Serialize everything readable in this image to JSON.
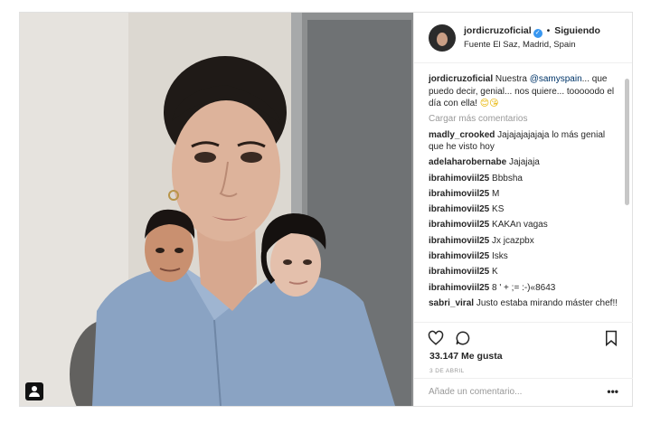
{
  "post": {
    "header": {
      "username": "jordicruzoficial",
      "verified": true,
      "separator": "•",
      "follow_status": "Siguiendo",
      "location": "Fuente El Saz, Madrid, Spain"
    },
    "caption": {
      "username": "jordicruzoficial",
      "text_before": " Nuestra ",
      "mention": "@samyspain",
      "text_after": "... que puedo decir, genial... nos quiere... tooooodo el día con ella! ",
      "emoji": "😊😘"
    },
    "load_more_label": "Cargar más comentarios",
    "comments": [
      {
        "user": "madly_crooked",
        "text": "Jajajajajajaja lo más genial que he visto hoy"
      },
      {
        "user": "adelaharobernabe",
        "text": "Jajajaja"
      },
      {
        "user": "ibrahimoviil25",
        "text": "Bbbsha"
      },
      {
        "user": "ibrahimoviil25",
        "text": "M"
      },
      {
        "user": "ibrahimoviil25",
        "text": "KS"
      },
      {
        "user": "ibrahimoviil25",
        "text": "KAKAn vagas"
      },
      {
        "user": "ibrahimoviil25",
        "text": "Jx jcazpbx"
      },
      {
        "user": "ibrahimoviil25",
        "text": "Isks"
      },
      {
        "user": "ibrahimoviil25",
        "text": "K"
      },
      {
        "user": "ibrahimoviil25",
        "text": "8 ' + ;= :-)«8643"
      },
      {
        "user": "sabri_viral",
        "text": "Justo estaba mirando máster chef!!"
      }
    ],
    "likes": "33.147 Me gusta",
    "date": "3 DE ABRIL",
    "add_comment_placeholder": "Añade un comentario...",
    "more_options": "•••",
    "icons": {
      "like": "heart-icon",
      "comment": "comment-bubble-icon",
      "save": "bookmark-icon",
      "tag": "user-tag-icon",
      "verified": "verified-badge-icon"
    },
    "colors": {
      "verified": "#3897f0",
      "mention": "#003569",
      "muted": "#999999",
      "text": "#262626"
    }
  }
}
